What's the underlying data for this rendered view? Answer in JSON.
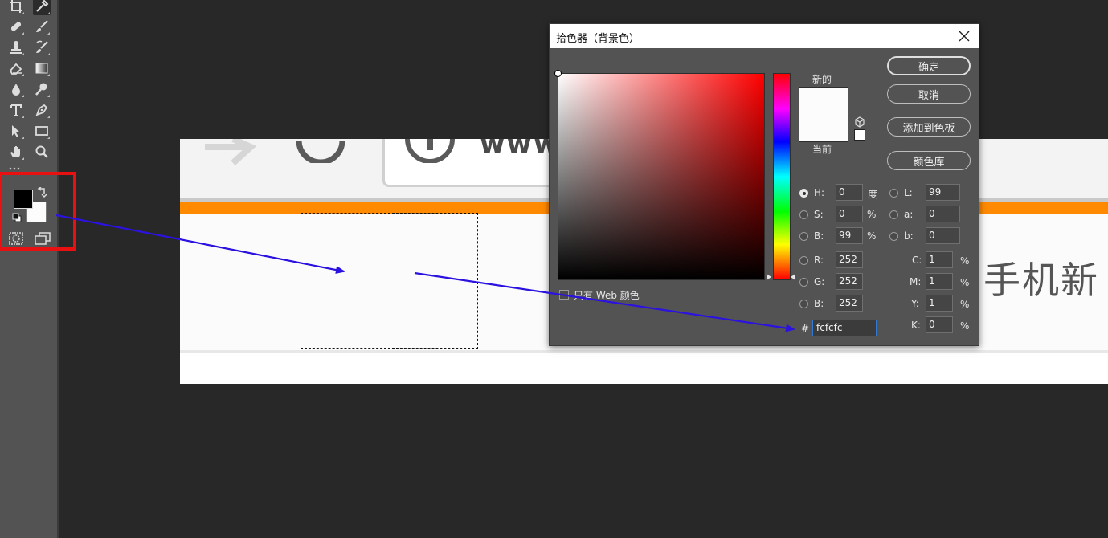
{
  "dialog": {
    "title": "拾色器（背景色）",
    "new_label": "新的",
    "current_label": "当前",
    "buttons": {
      "ok": "确定",
      "cancel": "取消",
      "add_to_swatches": "添加到色板",
      "color_libraries": "颜色库"
    },
    "web_only_label": "只有 Web 颜色",
    "web_only_checked": false,
    "new_color": "#fcfcfc",
    "current_color": "#fcfcfc",
    "selected_model": "H",
    "hsb": {
      "h_label": "H:",
      "h": "0",
      "h_unit": "度",
      "s_label": "S:",
      "s": "0",
      "s_unit": "%",
      "b_label": "B:",
      "b": "99",
      "b_unit": "%"
    },
    "rgb": {
      "r_label": "R:",
      "r": "252",
      "g_label": "G:",
      "g": "252",
      "b_label": "B:",
      "b": "252"
    },
    "lab": {
      "l_label": "L:",
      "l": "99",
      "a_label": "a:",
      "a": "0",
      "b_label": "b:",
      "b": "0"
    },
    "cmyk": {
      "c_label": "C:",
      "c": "1",
      "m_label": "M:",
      "m": "1",
      "y_label": "Y:",
      "y": "1",
      "k_label": "K:",
      "k": "0",
      "unit": "%"
    },
    "hex_hash": "#",
    "hex": "fcfcfc"
  },
  "toolbar": {
    "foreground_color": "#000000",
    "background_color": "#fcfcfc",
    "tools": [
      "crop-icon",
      "eyedropper-icon",
      "healing-brush-icon",
      "brush-icon",
      "clone-stamp-icon",
      "history-brush-icon",
      "eraser-icon",
      "gradient-icon",
      "blur-icon",
      "dodge-icon",
      "type-icon",
      "pen-icon",
      "path-selection-icon",
      "rectangle-icon",
      "hand-icon",
      "zoom-icon"
    ],
    "active_tool": "eyedropper-icon"
  },
  "canvas": {
    "page_text": "手机新",
    "url_partial": "www"
  },
  "colors": {
    "highlight_box": "#e81010",
    "annotation_arrow": "#2b12e0",
    "accent_bar": "#ff8a00"
  }
}
